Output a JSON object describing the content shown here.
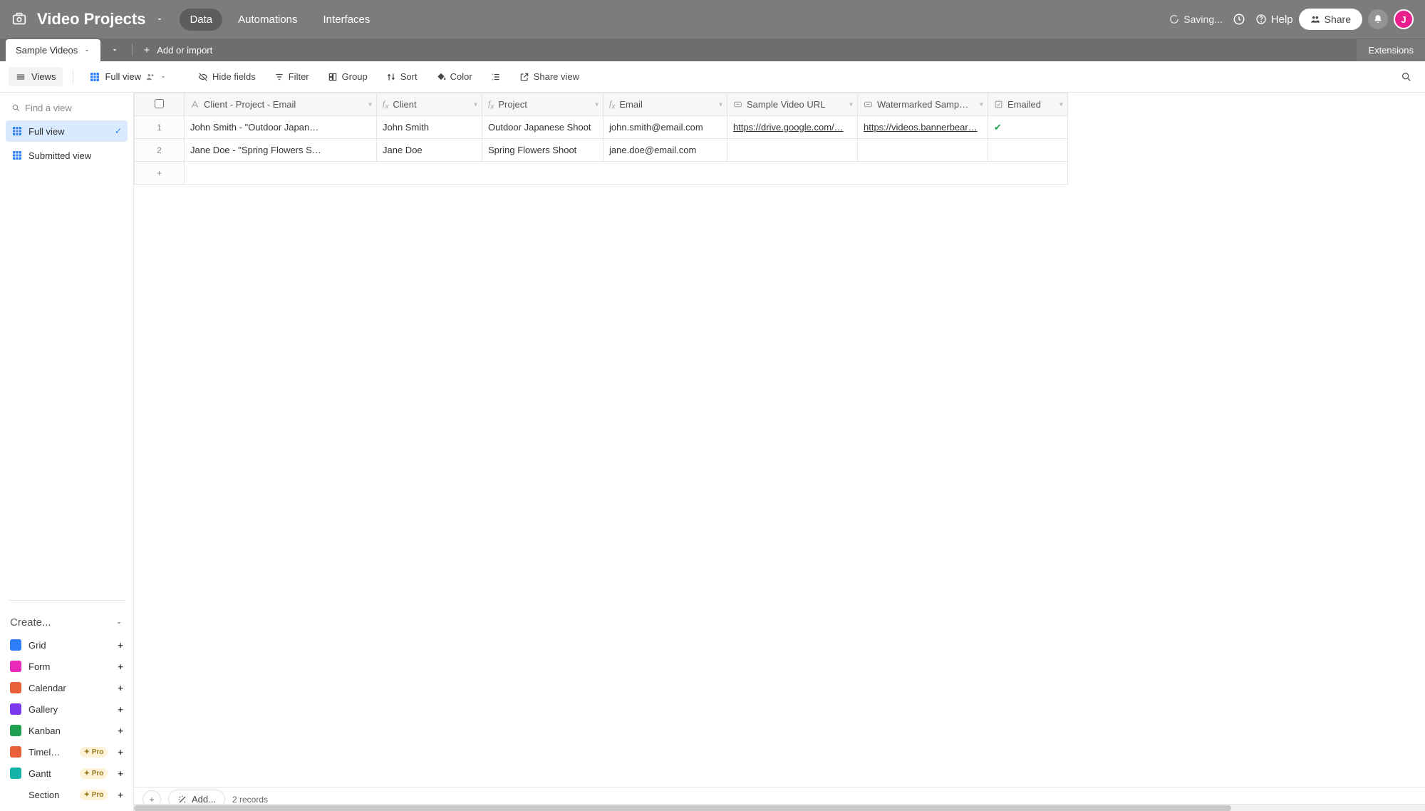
{
  "header": {
    "base_title": "Video Projects",
    "tabs": {
      "data": "Data",
      "automations": "Automations",
      "interfaces": "Interfaces"
    },
    "saving": "Saving...",
    "help": "Help",
    "share": "Share",
    "avatar_initial": "J",
    "extensions": "Extensions"
  },
  "tables": {
    "active": "Sample Videos",
    "add_import": "Add or import"
  },
  "toolbar": {
    "views": "Views",
    "view_name": "Full view",
    "hide_fields": "Hide fields",
    "filter": "Filter",
    "group": "Group",
    "sort": "Sort",
    "color": "Color",
    "share_view": "Share view"
  },
  "sidebar": {
    "find_placeholder": "Find a view",
    "views": [
      {
        "label": "Full view",
        "active": true
      },
      {
        "label": "Submitted view",
        "active": false
      }
    ],
    "create_label": "Create...",
    "view_types": [
      {
        "label": "Grid",
        "color": "#2d7ff9",
        "pro": false
      },
      {
        "label": "Form",
        "color": "#e929ba",
        "pro": false
      },
      {
        "label": "Calendar",
        "color": "#e8603c",
        "pro": false
      },
      {
        "label": "Gallery",
        "color": "#7c39ed",
        "pro": false
      },
      {
        "label": "Kanban",
        "color": "#20a04f",
        "pro": false
      },
      {
        "label": "Timel…",
        "color": "#e8603c",
        "pro": true
      },
      {
        "label": "Gantt",
        "color": "#12b3a8",
        "pro": true
      },
      {
        "label": "Section",
        "color": "",
        "pro": true
      }
    ],
    "pro_badge": "Pro"
  },
  "grid": {
    "columns": [
      {
        "key": "primary",
        "label": "Client - Project - Email",
        "icon": "text"
      },
      {
        "key": "client",
        "label": "Client",
        "icon": "fx"
      },
      {
        "key": "project",
        "label": "Project",
        "icon": "fx"
      },
      {
        "key": "email",
        "label": "Email",
        "icon": "fx"
      },
      {
        "key": "url",
        "label": "Sample Video URL",
        "icon": "link"
      },
      {
        "key": "wm",
        "label": "Watermarked Samp…",
        "icon": "link"
      },
      {
        "key": "emailed",
        "label": "Emailed",
        "icon": "checkbox"
      }
    ],
    "rows": [
      {
        "primary": "John Smith - \"Outdoor Japan…",
        "client": "John Smith",
        "project": "Outdoor Japanese Shoot",
        "email": "john.smith@email.com",
        "url": "https://drive.google.com/…",
        "wm": "https://videos.bannerbear…",
        "emailed": true
      },
      {
        "primary": "Jane Doe - \"Spring Flowers S…",
        "client": "Jane Doe",
        "project": "Spring Flowers Shoot",
        "email": "jane.doe@email.com",
        "url": "",
        "wm": "",
        "emailed": false
      }
    ],
    "record_count": "2 records",
    "add_label": "Add..."
  }
}
